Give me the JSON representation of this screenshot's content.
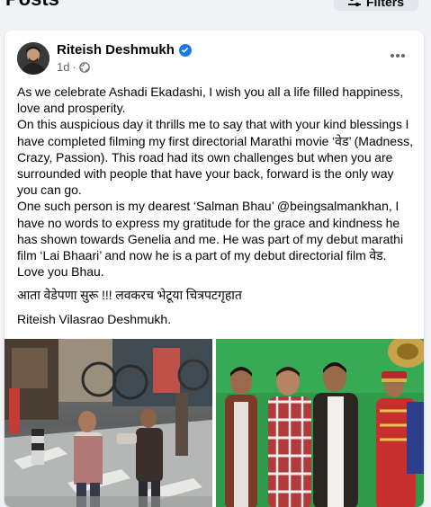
{
  "header": {
    "title": "Posts",
    "filters_label": "Filters"
  },
  "post": {
    "author": "Riteish Deshmukh",
    "verified_icon": "verified-badge-icon",
    "timestamp": "1d",
    "audience_icon": "globe-icon",
    "more_icon": "more-options-icon",
    "paragraphs": [
      "As we celebrate Ashadi Ekadashi, I wish you all a life filled happiness, love and prosperity.",
      "On this auspicious day it thrills me to say that with your kind blessings I have completed filming my first directorial Marathi movie ‘वेड’ (Madness, Crazy, Passion). This road had its own challenges but when you are surrounded with people that have your back, forward is the only way you can go.",
      "One such person is my dearest ‘Salman Bhau’ @beingsalmankhan, I have no words to express my gratitude for the grace and kindness he has shown towards Genelia and me. He was part of my debut marathi film ‘Lai Bhaari’ and now he is a part of my debut directorial film वेड. Love you Bhau.",
      "आता वेडेपणा सुरू !!! लवकरच भेटूया चित्रपटगृहात",
      "Riteish Vilasrao Deshmukh."
    ],
    "photos": [
      {
        "name": "street-scene-photo"
      },
      {
        "name": "band-group-photo"
      }
    ]
  },
  "colors": {
    "page_bg": "#f0f2f5",
    "card_bg": "#ffffff",
    "verified_blue": "#1877f2",
    "secondary_text": "#65676b"
  }
}
